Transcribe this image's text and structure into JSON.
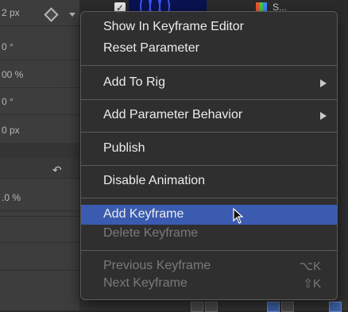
{
  "inspector": {
    "rows": [
      {
        "value": "2 px"
      },
      {
        "value": "0 °"
      },
      {
        "value": "00 %"
      },
      {
        "value": "0 °"
      },
      {
        "value": "0 px"
      },
      {
        "value": ".0 %"
      }
    ]
  },
  "timeline": {
    "layer_label": "S..."
  },
  "menu": {
    "items": [
      {
        "label": "Show In Keyframe Editor"
      },
      {
        "label": "Reset Parameter"
      },
      {
        "label": "Add To Rig"
      },
      {
        "label": "Add Parameter Behavior"
      },
      {
        "label": "Publish"
      },
      {
        "label": "Disable Animation"
      },
      {
        "label": "Add Keyframe"
      },
      {
        "label": "Delete Keyframe"
      },
      {
        "label": "Previous Keyframe",
        "shortcut": "⌥K"
      },
      {
        "label": "Next Keyframe",
        "shortcut": "⇧K"
      }
    ]
  },
  "colors": {
    "highlight": "#3a5bb0",
    "menu_bg": "#303030",
    "disabled_text": "#7a7a7a"
  },
  "icons": [
    "keyframe-diamond-icon",
    "dropdown-arrow-icon",
    "reset-arrow-icon",
    "checkbox-icon",
    "layer-icon",
    "submenu-arrow-icon",
    "mouse-cursor-icon"
  ]
}
